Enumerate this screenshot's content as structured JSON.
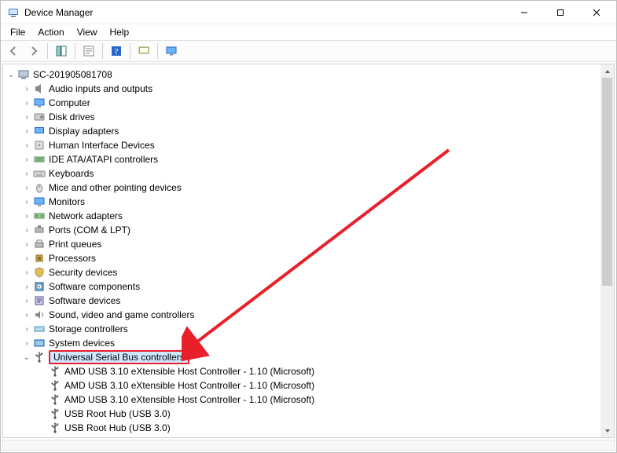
{
  "window": {
    "title": "Device Manager"
  },
  "menu": {
    "file": "File",
    "action": "Action",
    "view": "View",
    "help": "Help"
  },
  "toolbar": {
    "back": "Back",
    "forward": "Forward",
    "show_hide": "Show/Hide Console Tree",
    "properties": "Properties",
    "help": "Help",
    "scan": "Scan for hardware changes",
    "monitor": "View"
  },
  "tree": {
    "root": {
      "label": "SC-201905081708",
      "expanded": true
    },
    "categories": [
      {
        "label": "Audio inputs and outputs",
        "icon": "speaker-icon",
        "expanded": false
      },
      {
        "label": "Computer",
        "icon": "monitor-icon",
        "expanded": false
      },
      {
        "label": "Disk drives",
        "icon": "disk-icon",
        "expanded": false
      },
      {
        "label": "Display adapters",
        "icon": "display-adapter-icon",
        "expanded": false
      },
      {
        "label": "Human Interface Devices",
        "icon": "hid-icon",
        "expanded": false
      },
      {
        "label": "IDE ATA/ATAPI controllers",
        "icon": "ide-icon",
        "expanded": false
      },
      {
        "label": "Keyboards",
        "icon": "keyboard-icon",
        "expanded": false
      },
      {
        "label": "Mice and other pointing devices",
        "icon": "mouse-icon",
        "expanded": false
      },
      {
        "label": "Monitors",
        "icon": "monitor-icon",
        "expanded": false
      },
      {
        "label": "Network adapters",
        "icon": "network-icon",
        "expanded": false
      },
      {
        "label": "Ports (COM & LPT)",
        "icon": "port-icon",
        "expanded": false
      },
      {
        "label": "Print queues",
        "icon": "printer-icon",
        "expanded": false
      },
      {
        "label": "Processors",
        "icon": "cpu-icon",
        "expanded": false
      },
      {
        "label": "Security devices",
        "icon": "security-icon",
        "expanded": false
      },
      {
        "label": "Software components",
        "icon": "software-component-icon",
        "expanded": false
      },
      {
        "label": "Software devices",
        "icon": "software-device-icon",
        "expanded": false
      },
      {
        "label": "Sound, video and game controllers",
        "icon": "sound-icon",
        "expanded": false
      },
      {
        "label": "Storage controllers",
        "icon": "storage-controller-icon",
        "expanded": false
      },
      {
        "label": "System devices",
        "icon": "system-devices-icon",
        "expanded": false
      },
      {
        "label": "Universal Serial Bus controllers",
        "icon": "usb-icon",
        "expanded": true,
        "highlight": true,
        "children": [
          {
            "label": "AMD USB 3.10 eXtensible Host Controller - 1.10 (Microsoft)",
            "icon": "usb-icon"
          },
          {
            "label": "AMD USB 3.10 eXtensible Host Controller - 1.10 (Microsoft)",
            "icon": "usb-icon"
          },
          {
            "label": "AMD USB 3.10 eXtensible Host Controller - 1.10 (Microsoft)",
            "icon": "usb-icon"
          },
          {
            "label": "USB Root Hub (USB 3.0)",
            "icon": "usb-icon"
          },
          {
            "label": "USB Root Hub (USB 3.0)",
            "icon": "usb-icon"
          }
        ]
      }
    ]
  },
  "icons": {
    "speaker-icon": "speaker",
    "monitor-icon": "monitor",
    "disk-icon": "disk",
    "display-adapter-icon": "display",
    "hid-icon": "hid",
    "ide-icon": "ide",
    "keyboard-icon": "keyboard",
    "mouse-icon": "mouse",
    "network-icon": "network",
    "port-icon": "port",
    "printer-icon": "printer",
    "cpu-icon": "cpu",
    "security-icon": "security",
    "software-component-icon": "sw-comp",
    "software-device-icon": "sw-dev",
    "sound-icon": "sound",
    "storage-controller-icon": "storage",
    "system-devices-icon": "system",
    "usb-icon": "usb",
    "computer-root-icon": "pc"
  },
  "annotation": {
    "target": "Universal Serial Bus controllers",
    "type": "red-arrow"
  }
}
